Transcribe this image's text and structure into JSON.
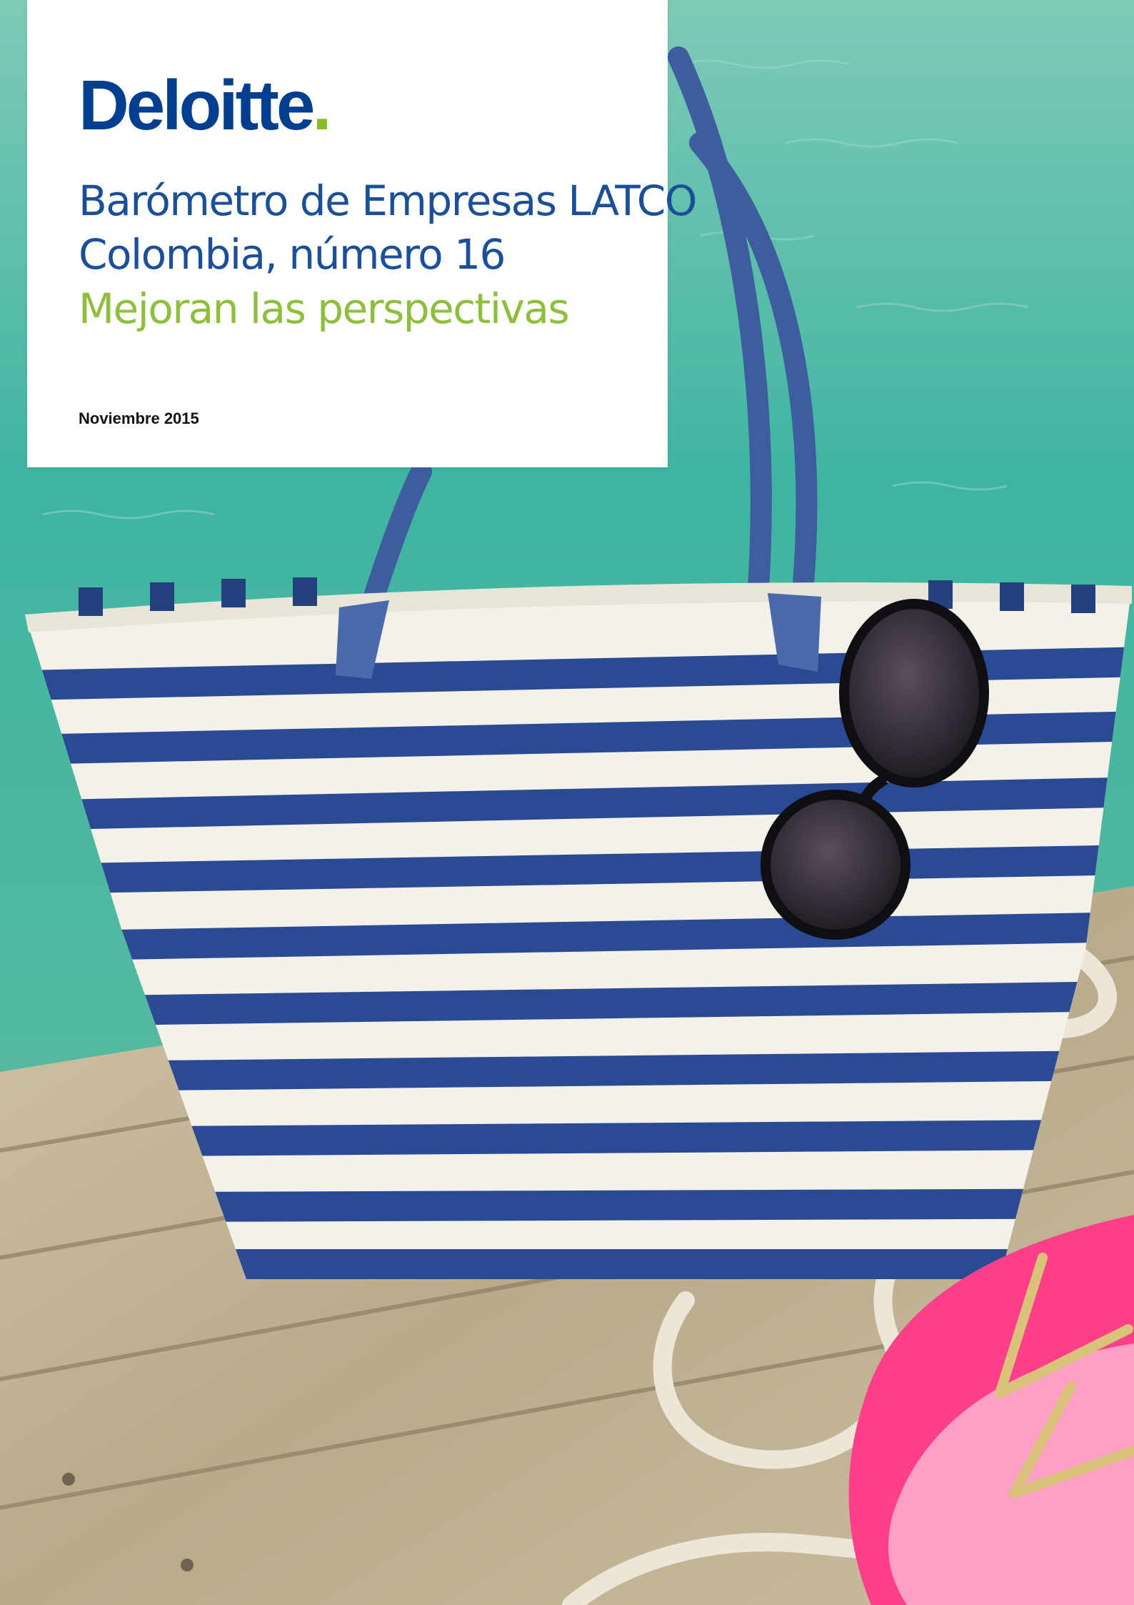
{
  "brand": {
    "name": "Deloitte",
    "dot": ".",
    "name_color": "#003f8f",
    "dot_color": "#86bc25"
  },
  "cover": {
    "title_line_1": "Barómetro de Empresas LATCO",
    "title_line_2": "Colombia, número 16",
    "subtitle": "Mejoran las perspectivas",
    "date": "Noviembre 2015",
    "title_color": "#1b4f98",
    "subtitle_color": "#8dbf3c"
  },
  "photo": {
    "description_icons": [
      "striped-beach-bag",
      "sunglasses",
      "rope",
      "pink-flip-flops",
      "wooden-dock",
      "turquoise-water"
    ]
  }
}
